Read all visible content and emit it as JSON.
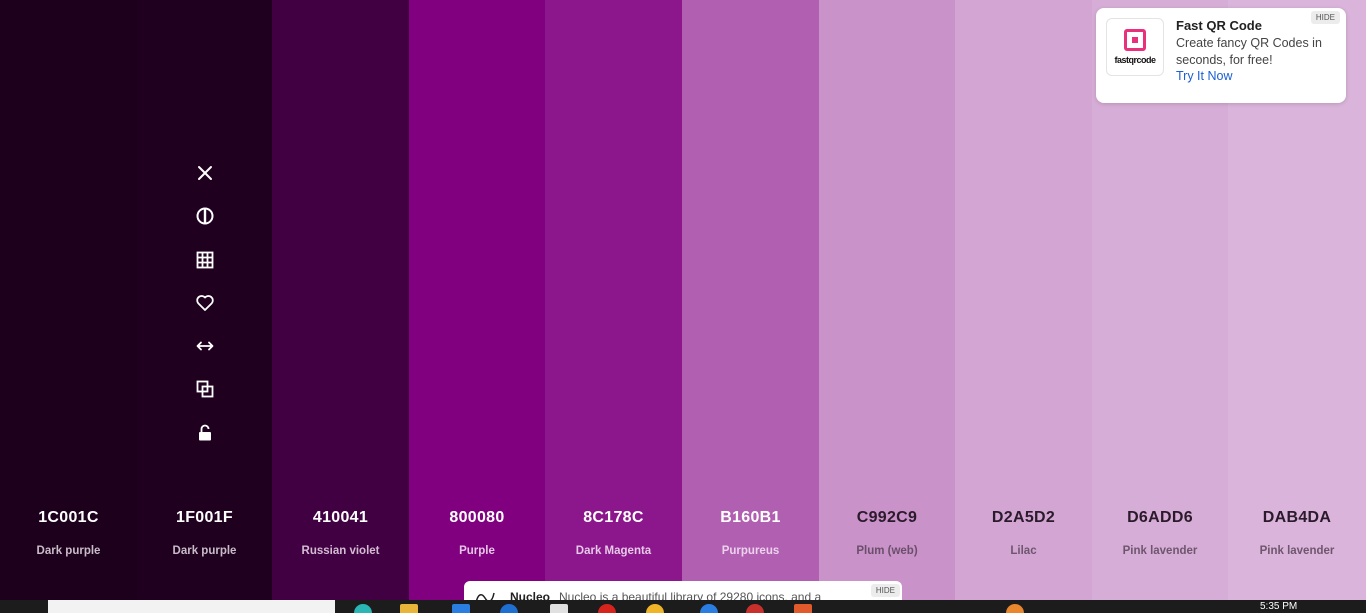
{
  "palette": {
    "swatches": [
      {
        "hex": "1C001C",
        "name": "Dark purple",
        "color": "#1C001C",
        "text_color": "#ffffff",
        "name_color": "#c9bcc9"
      },
      {
        "hex": "1F001F",
        "name": "Dark purple",
        "color": "#1F001F",
        "text_color": "#ffffff",
        "name_color": "#c9bcc9"
      },
      {
        "hex": "410041",
        "name": "Russian violet",
        "color": "#410041",
        "text_color": "#ffffff",
        "name_color": "#d3bcd3"
      },
      {
        "hex": "800080",
        "name": "Purple",
        "color": "#800080",
        "text_color": "#ffffff",
        "name_color": "#e5c6e5"
      },
      {
        "hex": "8C178C",
        "name": "Dark Magenta",
        "color": "#8C178C",
        "text_color": "#ffffff",
        "name_color": "#e6c9e6"
      },
      {
        "hex": "B160B1",
        "name": "Purpureus",
        "color": "#B160B1",
        "text_color": "#ffffff",
        "name_color": "#ecd2ec"
      },
      {
        "hex": "C992C9",
        "name": "Plum (web)",
        "color": "#C992C9",
        "text_color": "#2b1a2b",
        "name_color": "#6a4f6a"
      },
      {
        "hex": "D2A5D2",
        "name": "Lilac",
        "color": "#D2A5D2",
        "text_color": "#2b1a2b",
        "name_color": "#6e566e"
      },
      {
        "hex": "D6ADD6",
        "name": "Pink lavender",
        "color": "#D6ADD6",
        "text_color": "#2b1a2b",
        "name_color": "#6e566e"
      },
      {
        "hex": "DAB4DA",
        "name": "Pink lavender",
        "color": "#DAB4DA",
        "text_color": "#2b1a2b",
        "name_color": "#6e566e"
      }
    ]
  },
  "toolbar": {
    "icons": [
      "close-icon",
      "contrast-icon",
      "grid-icon",
      "heart-icon",
      "arrows-horizontal-icon",
      "copy-icon",
      "unlock-icon"
    ]
  },
  "ad_qr": {
    "logo_text": "fastqrcode",
    "title": "Fast QR Code",
    "description": "Create fancy QR Codes in seconds, for free!",
    "cta": "Try It Now",
    "hide_label": "HIDE"
  },
  "ad_nucleo": {
    "brand": "Nucleo",
    "text": "Nucleo is a beautiful library of 29280 icons, and a",
    "hide_label": "HIDE"
  },
  "taskbar": {
    "clock": "5:35 PM"
  }
}
